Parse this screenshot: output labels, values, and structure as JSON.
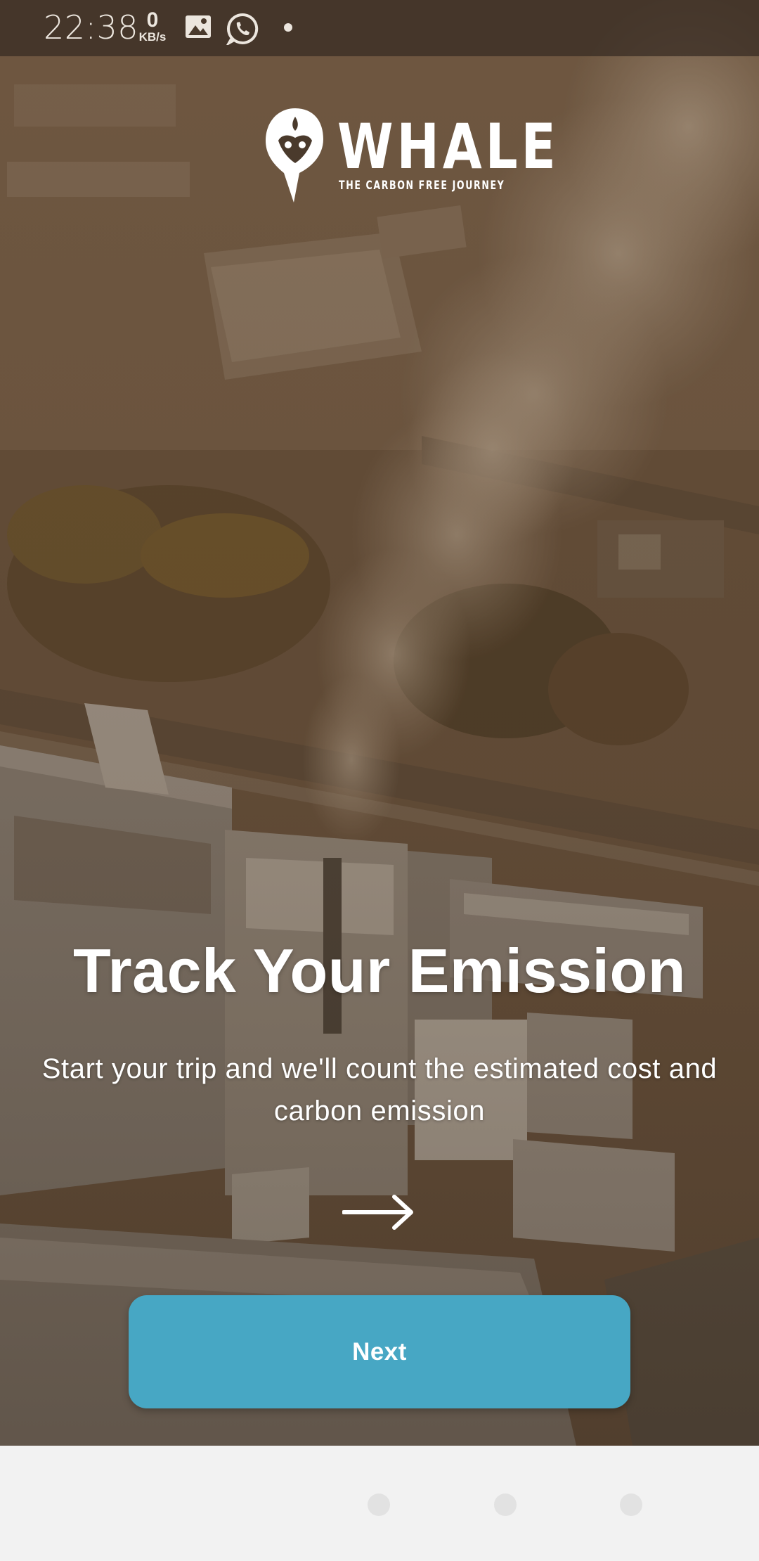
{
  "status_bar": {
    "time": "22:38",
    "net_speed_value": "0",
    "net_speed_unit": "KB/s",
    "icons": [
      "image-icon",
      "whatsapp-icon",
      "notification-dot-icon"
    ]
  },
  "logo": {
    "name": "WHALE",
    "tagline": "THE CARBON FREE JOURNEY"
  },
  "onboarding": {
    "title": "Track Your Emission",
    "subtitle": "Start your trip and we'll count the estimated cost and carbon emission",
    "arrow_icon": "arrow-right-icon",
    "next_label": "Next"
  },
  "navigation_bar": {
    "buttons": [
      "nav-back",
      "nav-home",
      "nav-recents"
    ]
  },
  "colors": {
    "accent": "#47a7c4",
    "text": "#ffffff",
    "background_overlay": "#5f4c3b",
    "navbar": "#f2f2f2"
  }
}
